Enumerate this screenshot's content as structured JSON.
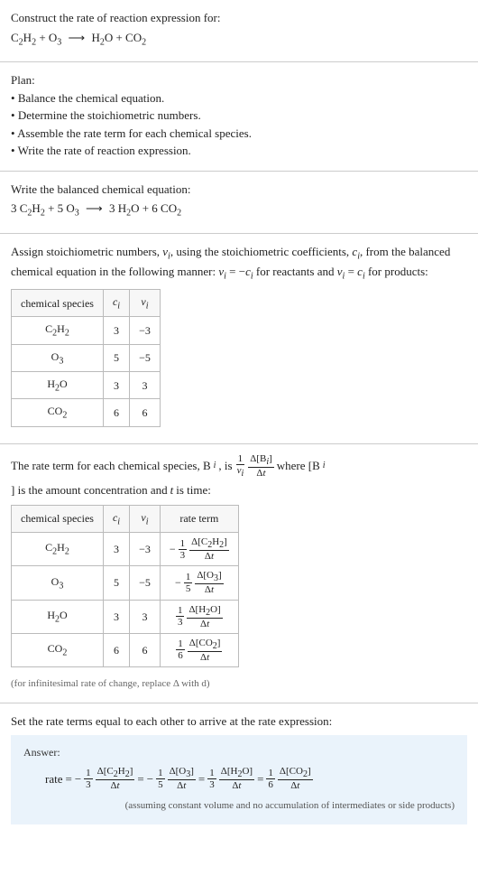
{
  "intro": {
    "prompt": "Construct the rate of reaction expression for:",
    "equation_html": "C<sub>2</sub>H<sub>2</sub> + O<sub>3</sub> <span class='arrow'>⟶</span> H<sub>2</sub>O + CO<sub>2</sub>"
  },
  "plan": {
    "heading": "Plan:",
    "items": [
      "Balance the chemical equation.",
      "Determine the stoichiometric numbers.",
      "Assemble the rate term for each chemical species.",
      "Write the rate of reaction expression."
    ]
  },
  "balanced": {
    "heading": "Write the balanced chemical equation:",
    "equation_html": "3 C<sub>2</sub>H<sub>2</sub> + 5 O<sub>3</sub> <span class='arrow'>⟶</span> 3 H<sub>2</sub>O + 6 CO<sub>2</sub>"
  },
  "stoich": {
    "text_html": "Assign stoichiometric numbers, <span class='italic'>ν<sub>i</sub></span>, using the stoichiometric coefficients, <span class='italic'>c<sub>i</sub></span>, from the balanced chemical equation in the following manner: <span class='italic'>ν<sub>i</sub></span> = −<span class='italic'>c<sub>i</sub></span> for reactants and <span class='italic'>ν<sub>i</sub></span> = <span class='italic'>c<sub>i</sub></span> for products:",
    "headers": {
      "species": "chemical species",
      "ci_html": "<span class='italic'>c<sub>i</sub></span>",
      "vi_html": "<span class='italic'>ν<sub>i</sub></span>"
    },
    "rows": [
      {
        "species_html": "C<sub>2</sub>H<sub>2</sub>",
        "ci": "3",
        "vi": "−3"
      },
      {
        "species_html": "O<sub>3</sub>",
        "ci": "5",
        "vi": "−5"
      },
      {
        "species_html": "H<sub>2</sub>O",
        "ci": "3",
        "vi": "3"
      },
      {
        "species_html": "CO<sub>2</sub>",
        "ci": "6",
        "vi": "6"
      }
    ]
  },
  "rateterm": {
    "text_pre": "The rate term for each chemical species, B",
    "text_mid1": ", is ",
    "frac1_num_html": "1",
    "frac1_den_html": "<span class='italic'>ν<sub>i</sub></span>",
    "frac2_num_html": "Δ[B<sub><span class='italic'>i</span></sub>]",
    "frac2_den_html": "Δ<span class='italic'>t</span>",
    "text_mid2": " where [B",
    "text_mid3": "] is the amount concentration and ",
    "text_t": "t",
    "text_end": " is time:",
    "headers": {
      "species": "chemical species",
      "ci_html": "<span class='italic'>c<sub>i</sub></span>",
      "vi_html": "<span class='italic'>ν<sub>i</sub></span>",
      "rate": "rate term"
    },
    "rows": [
      {
        "species_html": "C<sub>2</sub>H<sub>2</sub>",
        "ci": "3",
        "vi": "−3",
        "coef_num": "1",
        "coef_den": "3",
        "sign": "−",
        "conc_html": "Δ[C<sub>2</sub>H<sub>2</sub>]"
      },
      {
        "species_html": "O<sub>3</sub>",
        "ci": "5",
        "vi": "−5",
        "coef_num": "1",
        "coef_den": "5",
        "sign": "−",
        "conc_html": "Δ[O<sub>3</sub>]"
      },
      {
        "species_html": "H<sub>2</sub>O",
        "ci": "3",
        "vi": "3",
        "coef_num": "1",
        "coef_den": "3",
        "sign": "",
        "conc_html": "Δ[H<sub>2</sub>O]"
      },
      {
        "species_html": "CO<sub>2</sub>",
        "ci": "6",
        "vi": "6",
        "coef_num": "1",
        "coef_den": "6",
        "sign": "",
        "conc_html": "Δ[CO<sub>2</sub>]"
      }
    ],
    "footnote": "(for infinitesimal rate of change, replace Δ with d)"
  },
  "final": {
    "heading": "Set the rate terms equal to each other to arrive at the rate expression:",
    "answer_label": "Answer:",
    "rate_label": "rate",
    "equals": " = ",
    "dt_html": "Δ<span class='italic'>t</span>",
    "terms": [
      {
        "sign": "−",
        "num": "1",
        "den": "3",
        "conc_html": "Δ[C<sub>2</sub>H<sub>2</sub>]"
      },
      {
        "sign": "−",
        "num": "1",
        "den": "5",
        "conc_html": "Δ[O<sub>3</sub>]"
      },
      {
        "sign": "",
        "num": "1",
        "den": "3",
        "conc_html": "Δ[H<sub>2</sub>O]"
      },
      {
        "sign": "",
        "num": "1",
        "den": "6",
        "conc_html": "Δ[CO<sub>2</sub>]"
      }
    ],
    "assumption": "(assuming constant volume and no accumulation of intermediates or side products)"
  }
}
